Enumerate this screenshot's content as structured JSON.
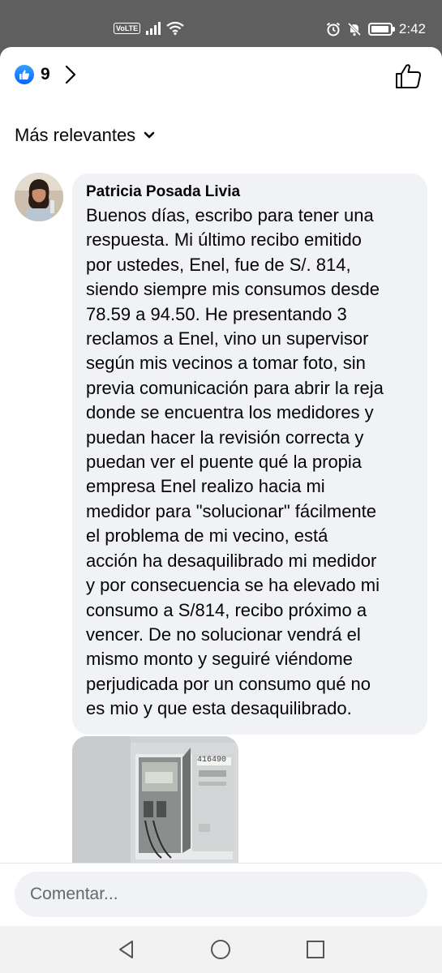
{
  "status_bar": {
    "network": "VoLTE",
    "time": "2:42",
    "icons": [
      "signal-icon",
      "wifi-icon",
      "alarm-icon",
      "mute-icon",
      "battery-icon"
    ]
  },
  "reactions": {
    "count": "9",
    "icon": "like-reaction-icon"
  },
  "sort": {
    "label": "Más relevantes",
    "icon": "chevron-down-icon"
  },
  "comment": {
    "author": "Patricia Posada Livia",
    "text": "Buenos días, escribo para   tener una\nrespuesta. Mi último recibo emitido\npor ustedes, Enel, fue de S/. 814,\nsiendo siempre mis consumos desde\n78.59 a 94.50. He presentando 3\nreclamos a Enel, vino un supervisor\nsegún mis vecinos a tomar foto, sin\nprevia comunicación para abrir la reja\ndonde se encuentra los medidores y\npuedan hacer la revisión correcta y\npuedan ver el puente qué la propia\nempresa Enel realizo hacia mi\nmedidor para \"solucionar\" fácilmente\nel problema de mi vecino, está\nacción ha desaquilibrado mi medidor\ny por consecuencia se ha elevado mi\nconsumo a S/814, recibo próximo a\nvencer. De no solucionar vendrá el\nmismo monto y seguiré viéndome\nperjudicada por un consumo qué no\nes mio y que esta desaquilibrado.",
    "photo_label": "416490"
  },
  "composer": {
    "placeholder": "Comentar..."
  },
  "nav": {
    "icons": [
      "back-icon",
      "home-icon",
      "recents-icon"
    ]
  }
}
